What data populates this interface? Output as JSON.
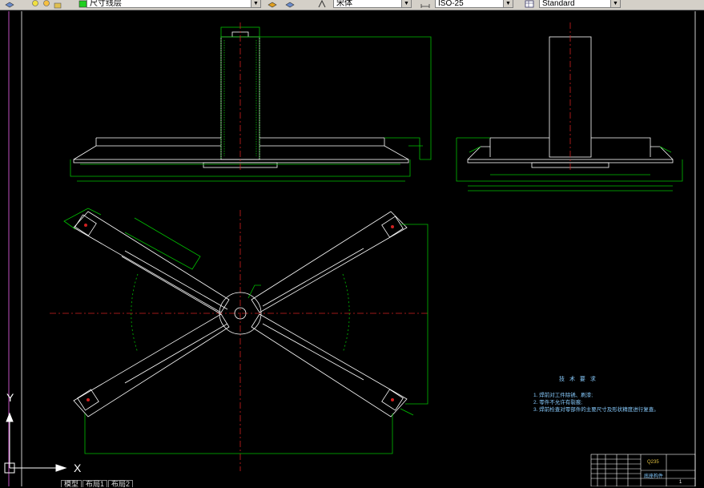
{
  "toolbar": {
    "layer_combo": "尺寸线层",
    "font_combo": "宋体",
    "dimstyle_combo": "ISO-25",
    "tablestyle_combo": "Standard"
  },
  "ucs": {
    "x_label": "X",
    "y_label": "Y"
  },
  "technical_requirements": {
    "title": "技 术 要 求",
    "items": [
      "1. 焊前对工件除锈、刷漆;",
      "2. 零件不允许有裂痕;",
      "3. 焊前检查对零部件的主要尺寸及形状精度进行复查。"
    ]
  },
  "title_block": {
    "material": "Q235",
    "part_name": "底座构件",
    "number": "1"
  },
  "layout_tabs": [
    "模型",
    "布局1",
    "布局2"
  ],
  "colors": {
    "background": "#000000",
    "outline": "#ffffff",
    "dimension": "#00c000",
    "centerline": "#d02020",
    "hatch": "#00c000",
    "text": "#80c8ff"
  }
}
